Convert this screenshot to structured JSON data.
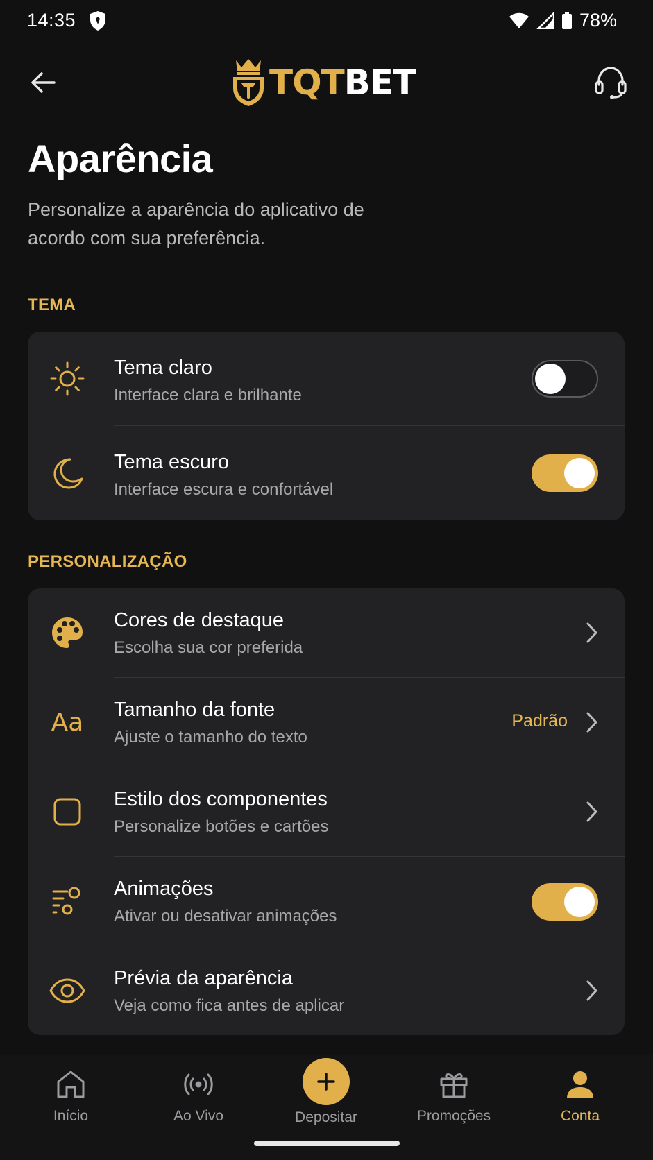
{
  "status_bar": {
    "time": "14:35",
    "battery": "78%",
    "icons": [
      "shield-icon",
      "wifi-icon",
      "signal-icon",
      "battery-icon"
    ]
  },
  "header": {
    "logo_part1": "TQT",
    "logo_part2": "BET",
    "back_icon": "arrow-left-icon",
    "support_icon": "headset-icon"
  },
  "page": {
    "title": "Aparência",
    "subtitle": "Personalize a aparência do aplicativo de acordo com sua preferência."
  },
  "sections": {
    "theme": {
      "label": "TEMA",
      "items": [
        {
          "title": "Tema claro",
          "desc": "Interface clara e brilhante",
          "icon": "sun-icon",
          "toggle": false
        },
        {
          "title": "Tema escuro",
          "desc": "Interface escura e confortável",
          "icon": "moon-icon",
          "toggle": true
        }
      ]
    },
    "personalization": {
      "label": "PERSONALIZAÇÃO",
      "items": [
        {
          "title": "Cores de destaque",
          "desc": "Escolha sua cor preferida",
          "icon": "palette-icon"
        },
        {
          "title": "Tamanho da fonte",
          "desc": "Ajuste o tamanho do texto",
          "icon": "font-size-icon",
          "icon_text": "Aa",
          "value": "Padrão"
        },
        {
          "title": "Estilo dos componentes",
          "desc": "Personalize botões e cartões",
          "icon": "rounded-square-icon"
        },
        {
          "title": "Animações",
          "desc": "Ativar ou desativar animações",
          "icon": "animation-icon",
          "toggle": true
        },
        {
          "title": "Prévia da aparência",
          "desc": "Veja como fica antes de aplicar",
          "icon": "eye-icon"
        }
      ]
    }
  },
  "bottom_nav": {
    "items": [
      {
        "label": "Início",
        "icon": "home-icon",
        "active": false
      },
      {
        "label": "Ao Vivo",
        "icon": "live-broadcast-icon",
        "active": false
      },
      {
        "label": "Depositar",
        "icon": "plus-icon",
        "active": false
      },
      {
        "label": "Promoções",
        "icon": "gift-icon",
        "active": false
      },
      {
        "label": "Conta",
        "icon": "user-icon",
        "active": true
      }
    ]
  },
  "colors": {
    "background": "#111112",
    "card": "#222224",
    "accent": "#e2b04a",
    "text_secondary": "#a8a8ab"
  }
}
